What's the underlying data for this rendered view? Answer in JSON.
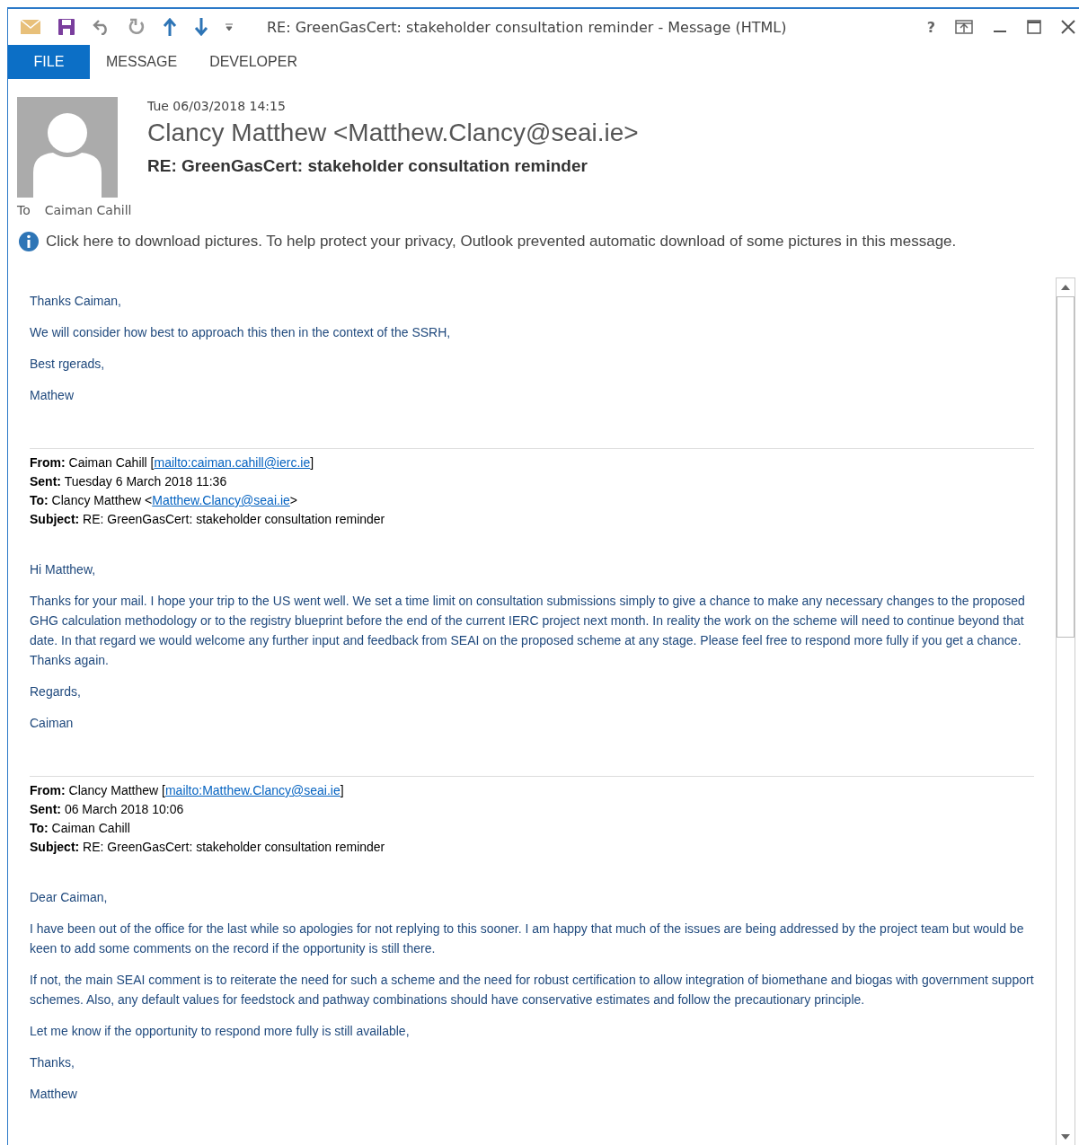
{
  "window": {
    "title": "RE: GreenGasCert: stakeholder consultation reminder - Message (HTML)",
    "controls": [
      "?"
    ]
  },
  "tabs": [
    {
      "label": "FILE",
      "selected": true
    },
    {
      "label": "MESSAGE",
      "selected": false
    },
    {
      "label": "DEVELOPER",
      "selected": false
    }
  ],
  "header": {
    "date": "Tue 06/03/2018 14:15",
    "sender": "Clancy Matthew <Matthew.Clancy@seai.ie>",
    "subject": "RE: GreenGasCert: stakeholder consultation reminder",
    "to_label": "To",
    "to": "Caiman Cahill"
  },
  "infobar": "Click here to download pictures. To help protect your privacy, Outlook prevented automatic download of some pictures in this message.",
  "body": [
    {
      "kind": "paragraph",
      "text": "Thanks Caiman,"
    },
    {
      "kind": "paragraph",
      "text": "We will consider how best to approach this then in the context of the SSRH,"
    },
    {
      "kind": "paragraph",
      "text": "Best rgerads,"
    },
    {
      "kind": "paragraph",
      "text": "Mathew"
    },
    {
      "kind": "quote_header",
      "fields": [
        {
          "label": "From:",
          "text": "Caiman Cahill [",
          "link": "mailto:caiman.cahill@ierc.ie",
          "after": "]"
        },
        {
          "label": "Sent:",
          "text": "Tuesday 6 March 2018 11:36"
        },
        {
          "label": "To:",
          "text": "Clancy Matthew <",
          "link": "Matthew.Clancy@seai.ie",
          "after": ">"
        },
        {
          "label": "Subject:",
          "text": "RE: GreenGasCert: stakeholder consultation reminder"
        }
      ]
    },
    {
      "kind": "paragraph",
      "text": "Hi Matthew,"
    },
    {
      "kind": "paragraph",
      "text": "Thanks for your mail. I hope your trip to the US went well. We set a time limit on consultation submissions simply to give a chance to make any necessary changes to the proposed GHG calculation methodology or to the registry blueprint before the end of the current IERC project next month. In reality the work on the scheme will need to continue beyond that date. In that regard we would welcome any further input and feedback from SEAI on the proposed scheme at any stage.  Please feel free to respond more fully if you get a chance. Thanks again."
    },
    {
      "kind": "paragraph",
      "text": "Regards,"
    },
    {
      "kind": "paragraph",
      "text": "Caiman"
    },
    {
      "kind": "quote_header",
      "fields": [
        {
          "label": "From:",
          "text": "Clancy Matthew [",
          "link": "mailto:Matthew.Clancy@seai.ie",
          "after": "]"
        },
        {
          "label": "Sent:",
          "text": "06 March 2018 10:06"
        },
        {
          "label": "To:",
          "text": "Caiman Cahill"
        },
        {
          "label": "Subject:",
          "text": "RE: GreenGasCert: stakeholder consultation reminder"
        }
      ]
    },
    {
      "kind": "paragraph",
      "text": "Dear Caiman,"
    },
    {
      "kind": "paragraph",
      "text": "I have been out of the office for the last while so apologies for not replying to this sooner. I am happy that much of the issues are being addressed by the project team but would be keen to add some comments on the record if the opportunity is still there."
    },
    {
      "kind": "paragraph",
      "text": "If not, the main SEAI comment is to reiterate the need for such a scheme and the need for robust certification to allow integration of biomethane and biogas with government support schemes. Also, any default values for feedstock and pathway combinations should have conservative estimates and follow the precautionary principle."
    },
    {
      "kind": "paragraph",
      "text": "Let me know if the opportunity to respond more fully is still available,"
    },
    {
      "kind": "paragraph",
      "text": "Thanks,"
    },
    {
      "kind": "paragraph",
      "text": "Matthew"
    }
  ]
}
